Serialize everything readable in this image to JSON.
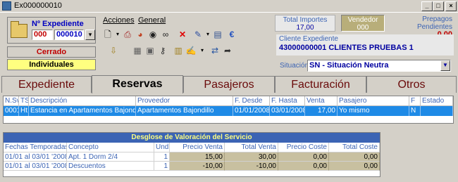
{
  "window": {
    "title": "Ex000000010"
  },
  "expediente": {
    "label": "Nº Expediente",
    "serie": "000",
    "numero": "000010",
    "estado": "Cerrado",
    "tipo": "Individuales"
  },
  "menu": {
    "acciones": "Acciones",
    "general": "General"
  },
  "toolbar": {
    "row1": [
      "new-document-icon",
      "print-icon",
      "pie-chart-icon",
      "eye-icon",
      "binoculars-icon",
      "delete-icon",
      "notes-icon",
      "database-icon",
      "euro-icon"
    ],
    "row2": [
      "export-icon",
      "stack-icon",
      "key-icon",
      "calendar-icon",
      "edit-icon",
      "swap-icon",
      "forward-icon"
    ]
  },
  "header": {
    "total_importes_label": "Total Importes",
    "total_importes_value": "17,00",
    "vendedor_label": "Vendedor",
    "vendedor_value": "000",
    "prepagos_label": "Prepagos Pendientes",
    "prepagos_value": "0,00",
    "cliente_label": "Cliente Expediente",
    "cliente_value": "43000000001 CLIENTES PRUEBAS 1",
    "situacion_label": "Situación",
    "situacion_value": "SN - Situación Neutra"
  },
  "tabs": [
    {
      "label": "Expediente"
    },
    {
      "label": "Reservas"
    },
    {
      "label": "Pasajeros"
    },
    {
      "label": "Facturación"
    },
    {
      "label": "Otros"
    }
  ],
  "reservas": {
    "columns": [
      "N.Sv",
      "TS",
      "Descripción",
      "Proveedor",
      "F. Desde",
      "F. Hasta",
      "Venta",
      "Pasajero",
      "F",
      "Estado"
    ],
    "rows": [
      [
        "0001",
        "Ht",
        "Estancia en Apartamentos Bajondillo",
        "Apartamentos Bajondillo",
        "01/01/2008",
        "03/01/2008",
        "17,00",
        "Yo mismo",
        "N",
        ""
      ]
    ]
  },
  "desglose": {
    "title": "Desglose de Valoración del Servicio",
    "columns": [
      "Fechas Temporadas",
      "Concepto",
      "Und",
      "Precio Venta",
      "Total Venta",
      "Precio Coste",
      "Total Coste"
    ],
    "rows": [
      [
        "01/01 al 03/01 '2008",
        "Apt. 1 Dorm 2/4",
        "1",
        "15,00",
        "30,00",
        "0,00",
        "0,00"
      ],
      [
        "01/01 al 03/01 '2008",
        "Descuentos",
        "1",
        "-10,00",
        "-10,00",
        "0,00",
        "0,00"
      ]
    ]
  },
  "colors": {
    "selection": "#1e8ae6",
    "label_blue": "#3c64b4",
    "value_bg": "#c8c0a0",
    "accent_red": "#c00000"
  }
}
